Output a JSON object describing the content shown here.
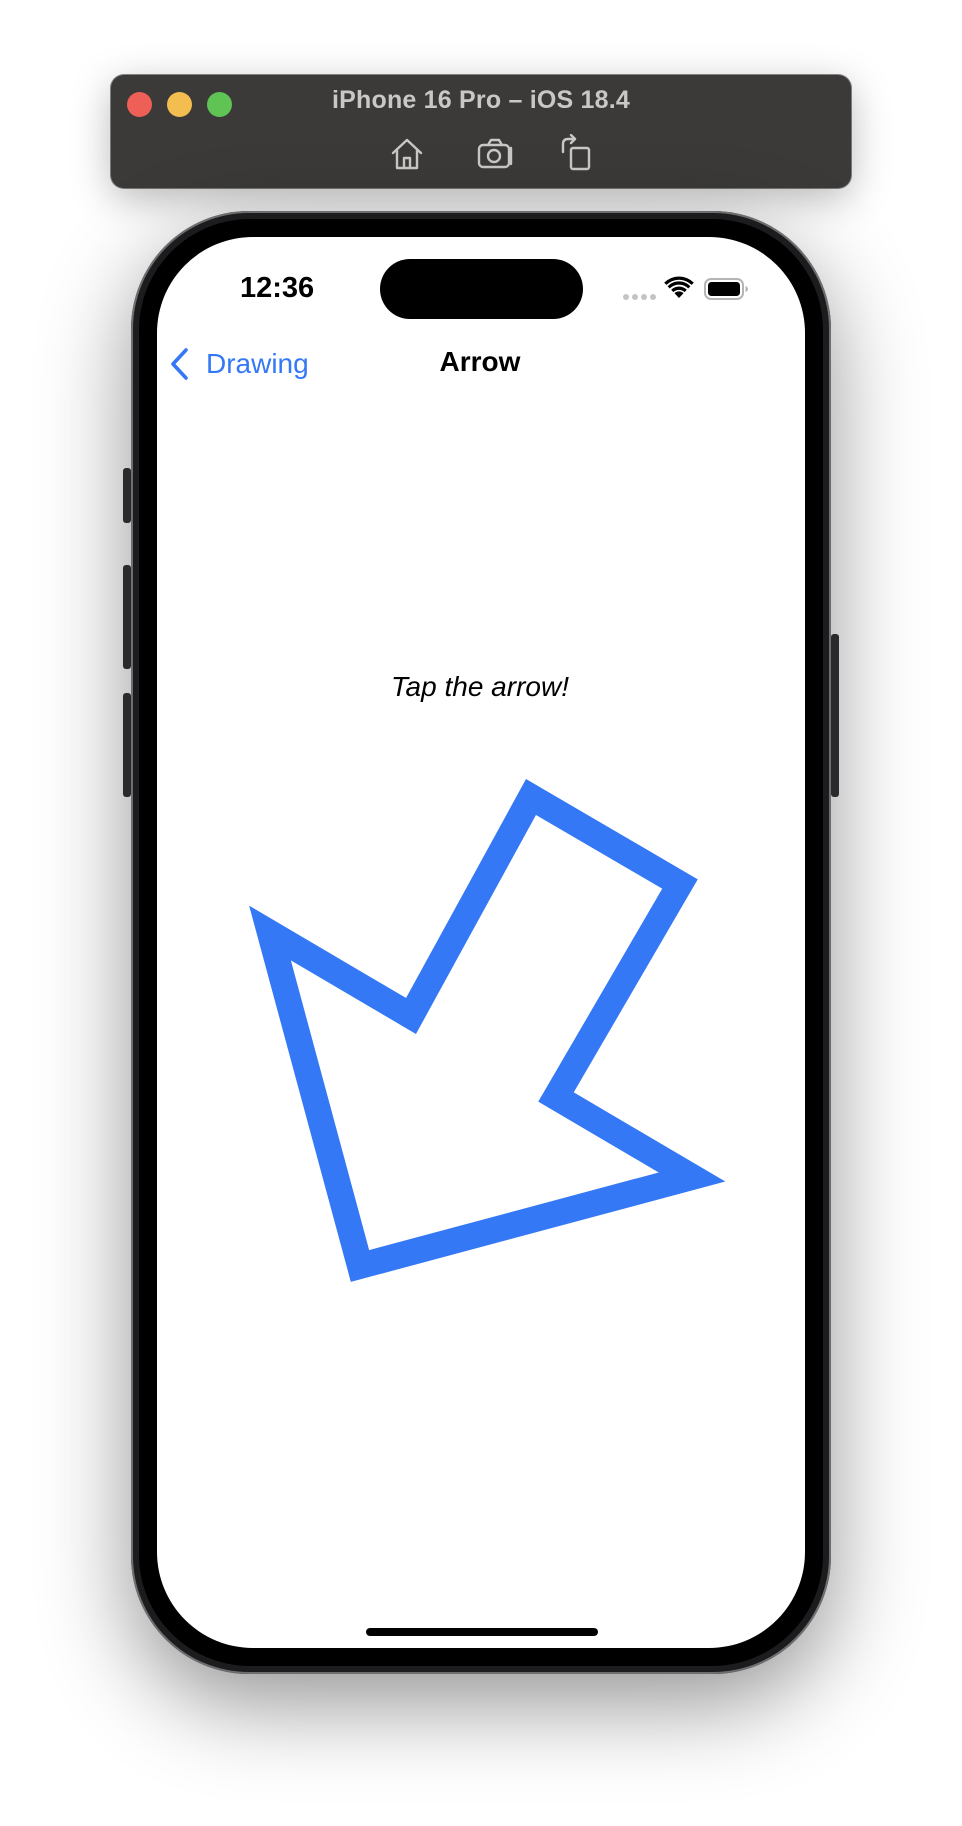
{
  "simulator": {
    "title": "iPhone 16 Pro – iOS 18.4",
    "toolbar": [
      "home-icon",
      "screenshot-icon",
      "rotate-icon"
    ]
  },
  "status_bar": {
    "time": "12:36"
  },
  "nav": {
    "back_label": "Drawing",
    "title": "Arrow"
  },
  "content": {
    "hint": "Tap the arrow!",
    "arrow_color": "#3478f6"
  },
  "colors": {
    "accent": "#3478f6",
    "traffic_red": "#ee5f57",
    "traffic_yellow": "#f4bd4f",
    "traffic_green": "#5fc454"
  }
}
